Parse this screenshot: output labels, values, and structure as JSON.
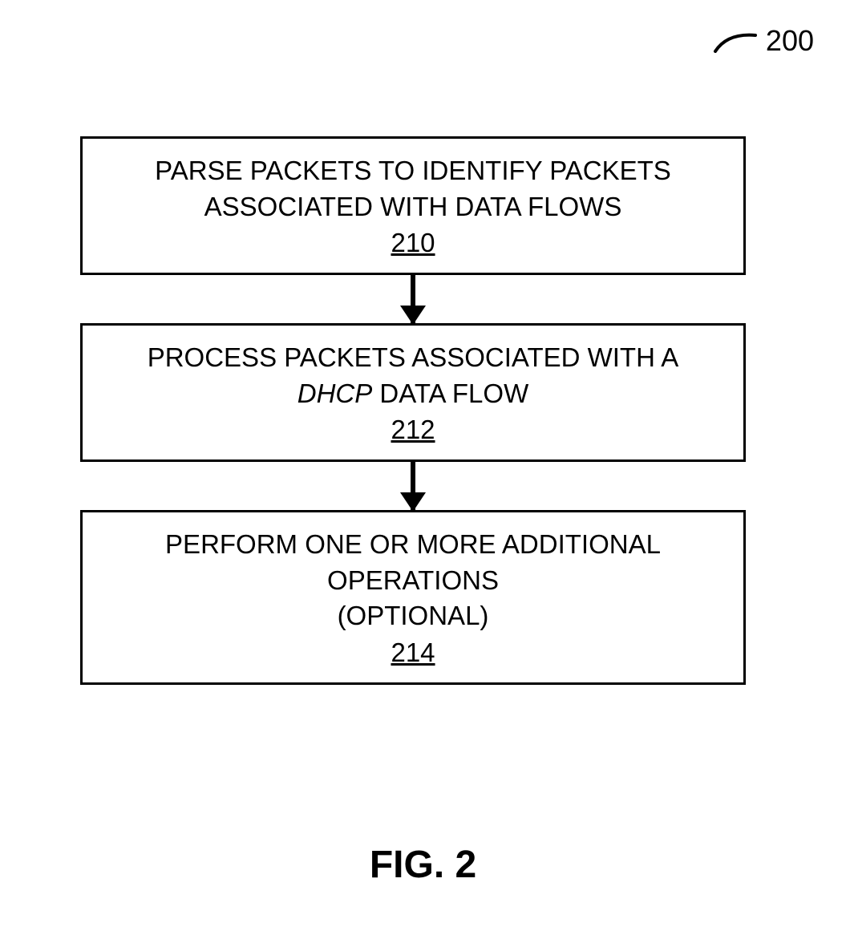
{
  "reference": {
    "number": "200"
  },
  "steps": [
    {
      "text_line1": "PARSE PACKETS TO IDENTIFY PACKETS",
      "text_line2": "ASSOCIATED WITH DATA FLOWS",
      "number": "210"
    },
    {
      "text_line1": "PROCESS PACKETS ASSOCIATED WITH A",
      "text_line2_prefix": "",
      "text_line2_italic": "DHCP",
      "text_line2_suffix": " DATA FLOW",
      "number": "212"
    },
    {
      "text_line1": "PERFORM ONE OR MORE ADDITIONAL",
      "text_line2": "OPERATIONS",
      "text_line3": "(OPTIONAL)",
      "number": "214"
    }
  ],
  "caption": "FIG. 2"
}
